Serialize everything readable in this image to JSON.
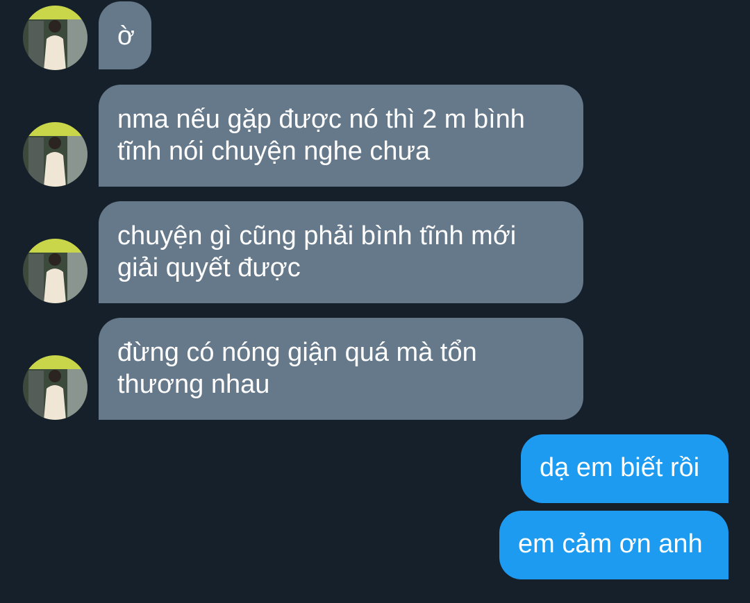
{
  "colors": {
    "background": "#16202b",
    "received_bubble": "#66798a",
    "sent_bubble": "#1d9bf0",
    "text": "#ffffff"
  },
  "avatar_icon": "contact-photo-icon",
  "messages": [
    {
      "direction": "received",
      "lines": [
        "ờ"
      ]
    },
    {
      "direction": "received",
      "lines": [
        "nma nếu gặp được nó thì 2 m bình",
        "tĩnh nói chuyện nghe chưa"
      ]
    },
    {
      "direction": "received",
      "lines": [
        "chuyện gì cũng phải bình tĩnh mới",
        "giải quyết được"
      ]
    },
    {
      "direction": "received",
      "lines": [
        "đừng có nóng giận quá mà tổn",
        "thương nhau"
      ]
    },
    {
      "direction": "sent",
      "lines": [
        "dạ em biết rồi"
      ]
    },
    {
      "direction": "sent",
      "lines": [
        "em cảm ơn anh"
      ]
    }
  ]
}
